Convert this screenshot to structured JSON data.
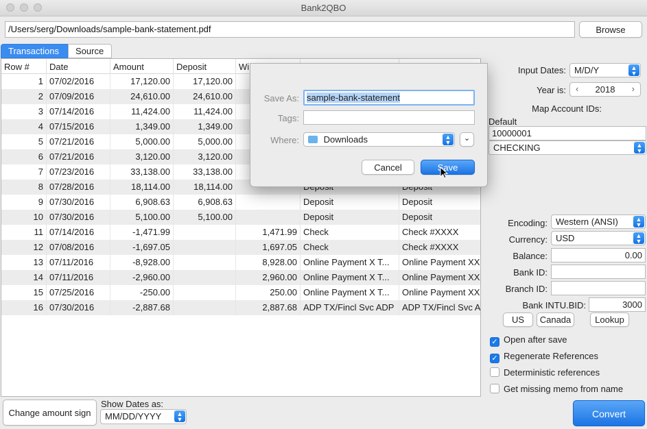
{
  "window": {
    "title": "Bank2QBO"
  },
  "file": {
    "path": "/Users/serg/Downloads/sample-bank-statement.pdf",
    "browse_label": "Browse"
  },
  "tabs": [
    {
      "label": "Transactions"
    },
    {
      "label": "Source"
    }
  ],
  "table": {
    "headers": [
      "Row #",
      "Date",
      "Amount",
      "Deposit",
      "Wi"
    ],
    "rows": [
      {
        "row": "1",
        "date": "07/02/2016",
        "amount": "17,120.00",
        "deposit": "17,120.00",
        "withdrawal": "",
        "type": "",
        "memo": ""
      },
      {
        "row": "2",
        "date": "07/09/2016",
        "amount": "24,610.00",
        "deposit": "24,610.00",
        "withdrawal": "",
        "type": "",
        "memo": ""
      },
      {
        "row": "3",
        "date": "07/14/2016",
        "amount": "11,424.00",
        "deposit": "11,424.00",
        "withdrawal": "",
        "type": "",
        "memo": ""
      },
      {
        "row": "4",
        "date": "07/15/2016",
        "amount": "1,349.00",
        "deposit": "1,349.00",
        "withdrawal": "",
        "type": "",
        "memo": ""
      },
      {
        "row": "5",
        "date": "07/21/2016",
        "amount": "5,000.00",
        "deposit": "5,000.00",
        "withdrawal": "",
        "type": "",
        "memo": ""
      },
      {
        "row": "6",
        "date": "07/21/2016",
        "amount": "3,120.00",
        "deposit": "3,120.00",
        "withdrawal": "",
        "type": "",
        "memo": ""
      },
      {
        "row": "7",
        "date": "07/23/2016",
        "amount": "33,138.00",
        "deposit": "33,138.00",
        "withdrawal": "",
        "type": "",
        "memo": ""
      },
      {
        "row": "8",
        "date": "07/28/2016",
        "amount": "18,114.00",
        "deposit": "18,114.00",
        "withdrawal": "",
        "type": "Deposit",
        "memo": "Deposit"
      },
      {
        "row": "9",
        "date": "07/30/2016",
        "amount": "6,908.63",
        "deposit": "6,908.63",
        "withdrawal": "",
        "type": "Deposit",
        "memo": "Deposit"
      },
      {
        "row": "10",
        "date": "07/30/2016",
        "amount": "5,100.00",
        "deposit": "5,100.00",
        "withdrawal": "",
        "type": "Deposit",
        "memo": "Deposit"
      },
      {
        "row": "11",
        "date": "07/14/2016",
        "amount": "-1,471.99",
        "deposit": "",
        "withdrawal": "1,471.99",
        "type": "Check",
        "memo": "Check #XXXX"
      },
      {
        "row": "12",
        "date": "07/08/2016",
        "amount": "-1,697.05",
        "deposit": "",
        "withdrawal": "1,697.05",
        "type": "Check",
        "memo": "Check #XXXX"
      },
      {
        "row": "13",
        "date": "07/11/2016",
        "amount": "-8,928.00",
        "deposit": "",
        "withdrawal": "8,928.00",
        "type": "Online Payment X T...",
        "memo": "Online Payment XX"
      },
      {
        "row": "14",
        "date": "07/11/2016",
        "amount": "-2,960.00",
        "deposit": "",
        "withdrawal": "2,960.00",
        "type": "Online Payment X T...",
        "memo": "Online Payment XX"
      },
      {
        "row": "15",
        "date": "07/25/2016",
        "amount": "-250.00",
        "deposit": "",
        "withdrawal": "250.00",
        "type": "Online Payment X T...",
        "memo": "Online Payment XX"
      },
      {
        "row": "16",
        "date": "07/30/2016",
        "amount": "-2,887.68",
        "deposit": "",
        "withdrawal": "2,887.68",
        "type": "ADP TX/Fincl Svc ADP",
        "memo": "ADP TX/Fincl Svc A"
      }
    ]
  },
  "settings": {
    "input_dates_label": "Input Dates:",
    "input_dates_value": "M/D/Y",
    "year_label": "Year is:",
    "year_value": "2018",
    "map_label": "Map Account IDs:",
    "default_label": "Default",
    "account_id": "10000001",
    "account_type": "CHECKING",
    "encoding_label": "Encoding:",
    "encoding_value": "Western (ANSI)",
    "currency_label": "Currency:",
    "currency_value": "USD",
    "balance_label": "Balance:",
    "balance_value": "0.00",
    "bank_id_label": "Bank ID:",
    "bank_id_value": "",
    "branch_id_label": "Branch ID:",
    "branch_id_value": "",
    "intu_label": "Bank INTU.BID:",
    "intu_value": "3000",
    "us_label": "US",
    "canada_label": "Canada",
    "lookup_label": "Lookup",
    "checks": [
      {
        "label": "Open after save",
        "checked": true
      },
      {
        "label": "Regenerate References",
        "checked": true
      },
      {
        "label": "Deterministic references",
        "checked": false
      },
      {
        "label": "Get missing memo from name",
        "checked": false
      }
    ]
  },
  "bottom": {
    "change_sign_label": "Change amount sign",
    "show_dates_label": "Show Dates as:",
    "show_dates_value": "MM/DD/YYYY",
    "convert_label": "Convert"
  },
  "dialog": {
    "save_as_label": "Save As:",
    "save_as_value": "sample-bank-statement",
    "tags_label": "Tags:",
    "tags_value": "",
    "where_label": "Where:",
    "where_value": "Downloads",
    "cancel_label": "Cancel",
    "save_label": "Save"
  },
  "colors": {
    "accent": "#1a7ae8",
    "tab_active": "#3b8cf0"
  }
}
